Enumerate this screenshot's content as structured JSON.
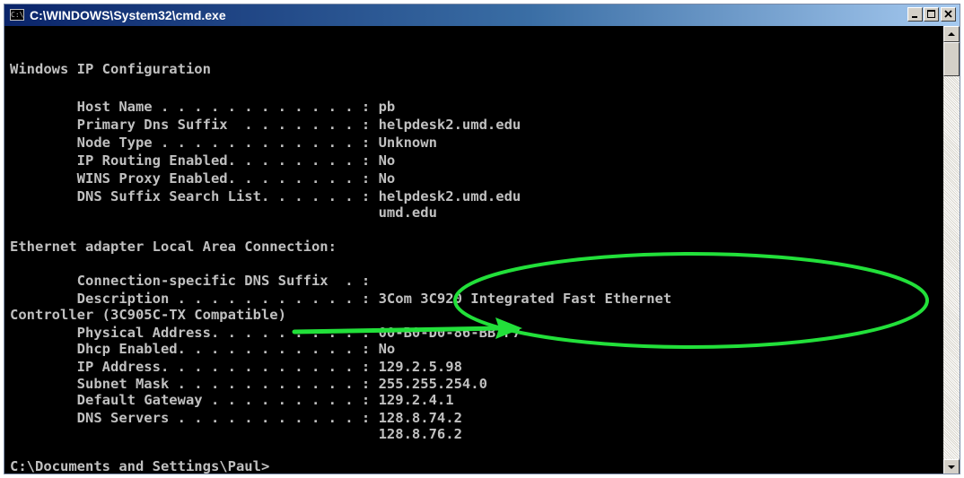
{
  "window": {
    "title": "C:\\WINDOWS\\System32\\cmd.exe",
    "app_icon_text": "C:\\",
    "controls": [
      "minimize",
      "maximize",
      "close"
    ]
  },
  "console": {
    "lines": [
      "Windows IP Configuration",
      "",
      "        Host Name . . . . . . . . . . . . : pb",
      "        Primary Dns Suffix  . . . . . . . : helpdesk2.umd.edu",
      "        Node Type . . . . . . . . . . . . : Unknown",
      "        IP Routing Enabled. . . . . . . . : No",
      "        WINS Proxy Enabled. . . . . . . . : No",
      "        DNS Suffix Search List. . . . . . : helpdesk2.umd.edu",
      "                                            umd.edu",
      "",
      "Ethernet adapter Local Area Connection:",
      "",
      "        Connection-specific DNS Suffix  . :",
      "        Description . . . . . . . . . . . : 3Com 3C920 Integrated Fast Ethernet",
      "Controller (3C905C-TX Compatible)",
      "        Physical Address. . . . . . . . . : 00-B0-D0-86-BB-F7",
      "        Dhcp Enabled. . . . . . . . . . . : No",
      "        IP Address. . . . . . . . . . . . : 129.2.5.98",
      "        Subnet Mask . . . . . . . . . . . : 255.255.254.0",
      "        Default Gateway . . . . . . . . . : 129.2.4.1",
      "        DNS Servers . . . . . . . . . . . : 128.8.74.2",
      "                                            128.8.76.2",
      "",
      "C:\\Documents and Settings\\Paul>"
    ]
  },
  "annotation": {
    "color": "#22e03a",
    "shapes": [
      "ellipse",
      "arrow"
    ]
  },
  "colors": {
    "console_text": "#c0c0c0",
    "console_background": "#000000",
    "title_bar_start": "#0a246a",
    "title_bar_end": "#a6caf0"
  }
}
